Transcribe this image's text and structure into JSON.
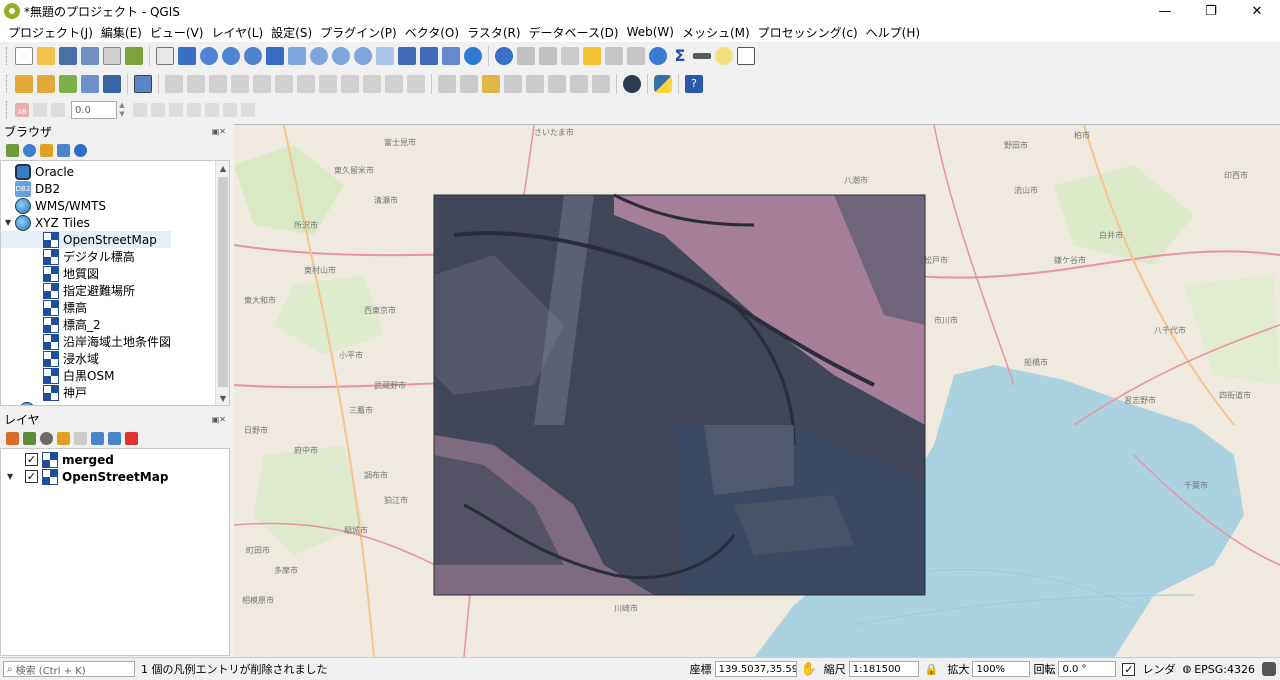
{
  "window": {
    "title": "*無題のプロジェクト - QGIS",
    "minimize": "—",
    "maximize": "❐",
    "close": "✕"
  },
  "menu": [
    "プロジェクト(J)",
    "編集(E)",
    "ビュー(V)",
    "レイヤ(L)",
    "設定(S)",
    "プラグイン(P)",
    "ベクタ(O)",
    "ラスタ(R)",
    "データベース(D)",
    "Web(W)",
    "メッシュ(M)",
    "プロセッシング(c)",
    "ヘルプ(H)"
  ],
  "label_toolbar": {
    "size_value": "0.0"
  },
  "browser": {
    "title": "ブラウザ",
    "items": [
      {
        "label": "Oracle",
        "icon": "oracle-icon"
      },
      {
        "label": "DB2",
        "icon": "db2-icon",
        "icon_text": "DB2"
      },
      {
        "label": "WMS/WMTS",
        "icon": "globe-icon"
      },
      {
        "label": "XYZ Tiles",
        "icon": "globe-icon"
      },
      {
        "label": "OpenStreetMap",
        "icon": "xyz-tile-icon"
      },
      {
        "label": "デジタル標高",
        "icon": "xyz-tile-icon"
      },
      {
        "label": "地質図",
        "icon": "xyz-tile-icon"
      },
      {
        "label": "指定避難場所",
        "icon": "xyz-tile-icon"
      },
      {
        "label": "標高",
        "icon": "xyz-tile-icon"
      },
      {
        "label": "標高_2",
        "icon": "xyz-tile-icon"
      },
      {
        "label": "沿岸海域土地条件図",
        "icon": "xyz-tile-icon"
      },
      {
        "label": "浸水域",
        "icon": "xyz-tile-icon"
      },
      {
        "label": "白黒OSM",
        "icon": "xyz-tile-icon"
      },
      {
        "label": "神戸",
        "icon": "xyz-tile-icon"
      }
    ]
  },
  "layers": {
    "title": "レイヤ",
    "items": [
      {
        "label": "merged",
        "checked": true
      },
      {
        "label": "OpenStreetMap",
        "checked": true
      }
    ]
  },
  "map": {
    "place_labels": [
      "さいたま市",
      "富士見市",
      "所沢市",
      "東村山市",
      "東大和市",
      "小平市",
      "西東京市",
      "武蔵野市",
      "三鷹市",
      "調布市",
      "府中市",
      "稲城市",
      "町田市",
      "相模原市",
      "川崎市",
      "八潮市",
      "柏市",
      "流山市",
      "鎌ケ谷市",
      "白井市",
      "船橋市",
      "習志野市",
      "市川市",
      "千葉市",
      "四街道市",
      "八千代市",
      "印西市",
      "松戸市",
      "野田市",
      "東久留米市",
      "清瀬市",
      "狛江市",
      "多摩市",
      "日野市"
    ],
    "sea_color": "#aad3df",
    "land_color": "#efe9e0"
  },
  "status": {
    "search_placeholder": "検索 (Ctrl + K)",
    "message": "1 個の凡例エントリが削除されました",
    "coord_label": "座標",
    "coord_value": "139.5037,35.5997",
    "scale_label": "縮尺",
    "scale_value": "1:181500",
    "magnifier_label": "拡大",
    "magnifier_value": "100%",
    "rotation_label": "回転",
    "rotation_value": "0.0 °",
    "render_label": "レンダ",
    "crs_value": "EPSG:4326"
  }
}
